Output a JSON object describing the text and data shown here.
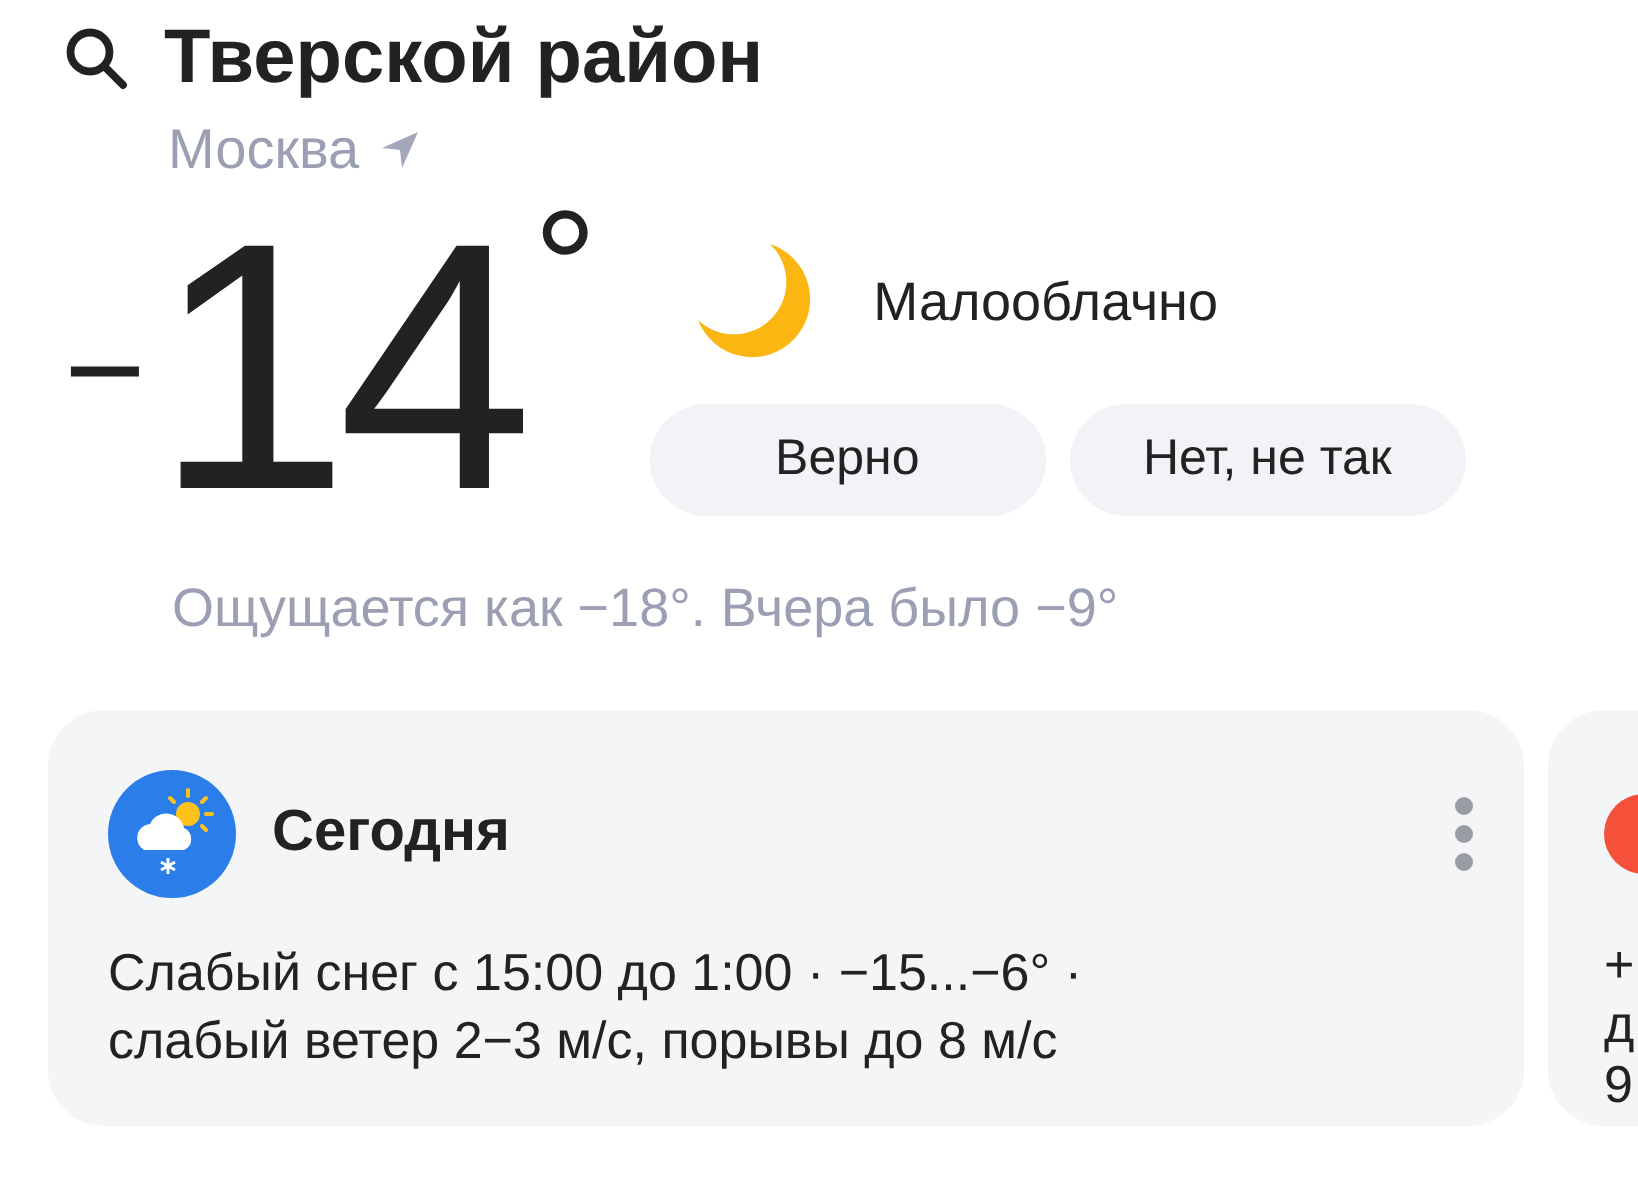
{
  "header": {
    "title": "Тверской район",
    "city": "Москва"
  },
  "current": {
    "sign": "−",
    "temperature": "14",
    "degree": "°",
    "condition": "Малооблачно",
    "feedback_buttons": [
      "Верно",
      "Нет, не так"
    ],
    "feels_like": "Ощущается как −18°. Вчера было −9°"
  },
  "cards": [
    {
      "kind": "forecast",
      "title": "Сегодня",
      "text": "Слабый снег с 15:00 до 1:00 · −15...−6° · слабый ветер 2−3 м/с, порывы до 8 м/с"
    },
    {
      "kind": "peek",
      "lines": [
        "+",
        "д",
        "9"
      ]
    }
  ]
}
